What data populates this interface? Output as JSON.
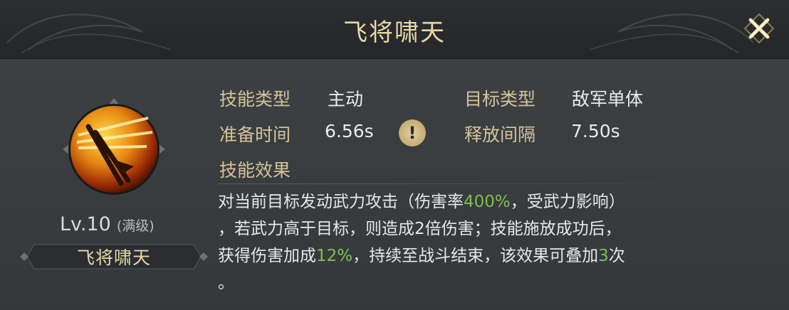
{
  "header": {
    "title": "飞将啸天"
  },
  "skill": {
    "level": "Lv.10",
    "level_max": "(满级)",
    "name": "飞将啸天"
  },
  "info": {
    "type_label": "技能类型",
    "type_value": "主动",
    "target_label": "目标类型",
    "target_value": "敌军单体",
    "prep_label": "准备时间",
    "prep_value": "6.56s",
    "interval_label": "释放间隔",
    "interval_value": "7.50s",
    "info_icon": "!"
  },
  "effect": {
    "label": "技能效果",
    "p1": "对当前目标发动武力攻击（伤害率",
    "v1": "400%",
    "p2": "，受武力影响）",
    "p3": "，若武力高于目标，则造成2倍伤害；技能施放成功后，",
    "p4": "获得伤害加成",
    "v2": "12%",
    "p5": "，持续至战斗结束，该效果可叠加",
    "v3": "3",
    "p6": "次",
    "p7": "。"
  },
  "colors": {
    "title_gold": "#e8d7a6",
    "label_gold": "#d4c29a",
    "highlight_green": "#7fbf4f",
    "panel_bg": "#3a3d40"
  },
  "icons": {
    "close": "close-x-icon",
    "skill": "spear-burst-icon",
    "info": "exclamation-icon"
  }
}
